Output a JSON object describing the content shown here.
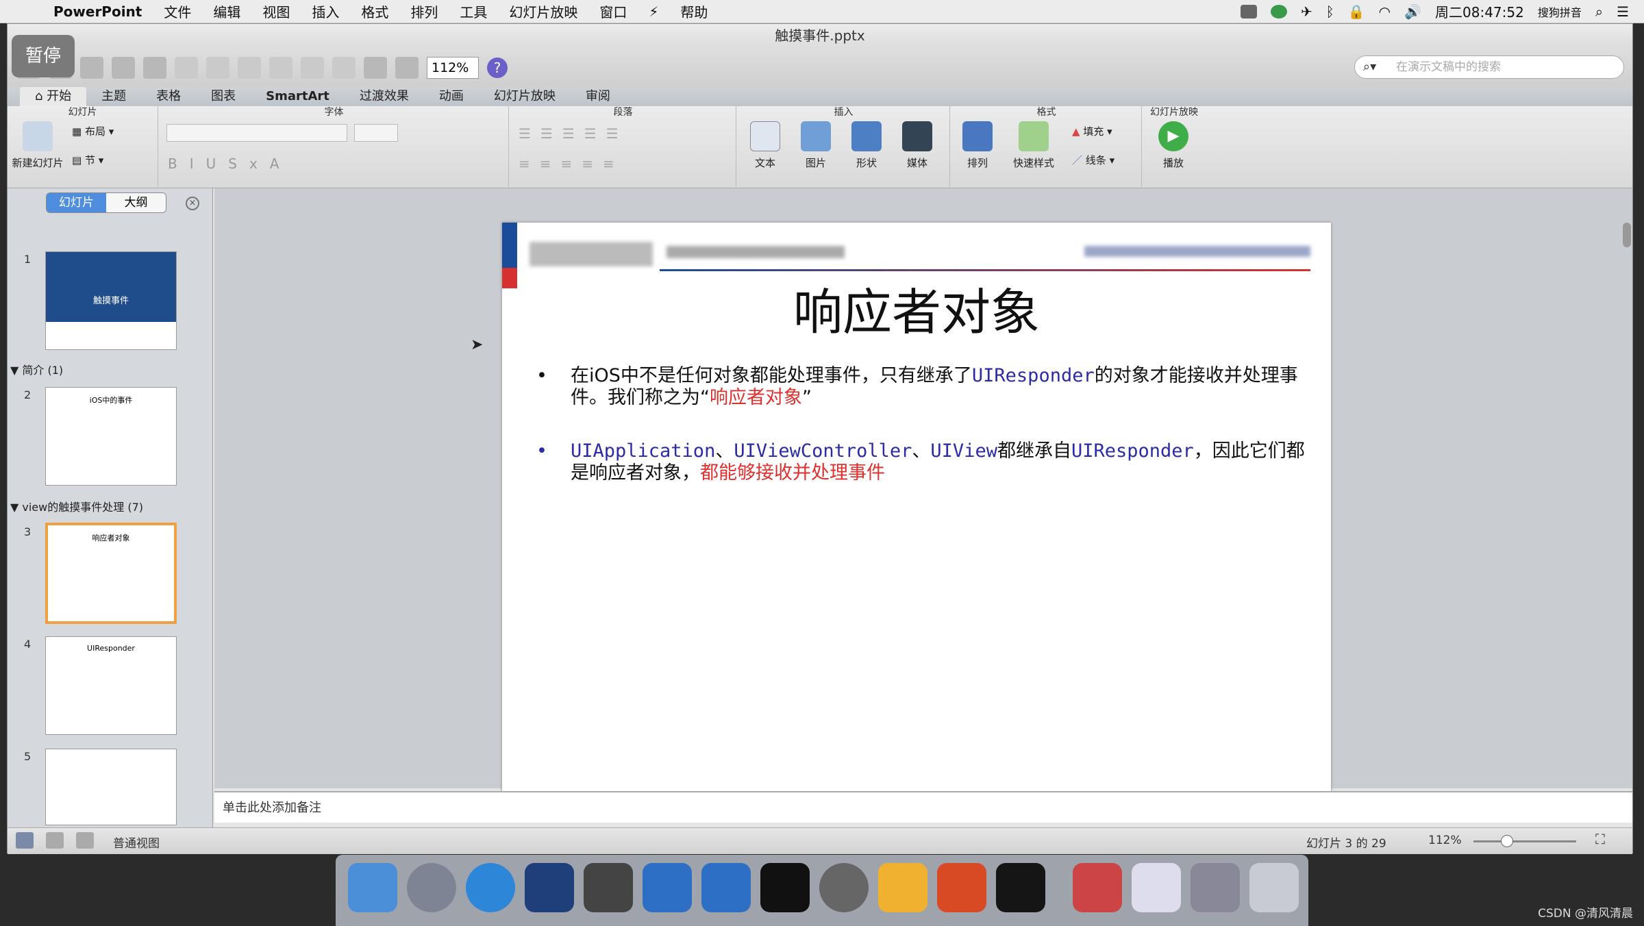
{
  "menubar": {
    "app": "PowerPoint",
    "items": [
      "文件",
      "编辑",
      "视图",
      "插入",
      "格式",
      "排列",
      "工具",
      "幻灯片放映",
      "窗口",
      "帮助"
    ],
    "clock": "周二08:47:52",
    "ime": "搜狗拼音"
  },
  "window": {
    "title": "触摸事件.pptx",
    "pause_label": "暂停",
    "zoom": "112%",
    "help": "?",
    "search_placeholder": "在演示文稿中的搜索"
  },
  "ribbon": {
    "tabs": [
      "开始",
      "主题",
      "表格",
      "图表",
      "SmartArt",
      "过渡效果",
      "动画",
      "幻灯片放映",
      "审阅"
    ],
    "groups": {
      "slides": "幻灯片",
      "font": "字体",
      "paragraph": "段落",
      "insert": "插入",
      "format": "格式",
      "slideshow": "幻灯片放映"
    },
    "labels": {
      "new_slide": "新建幻灯片",
      "layout": "布局",
      "section": "节",
      "text": "文本",
      "picture": "图片",
      "shape": "形状",
      "media": "媒体",
      "arrange": "排列",
      "quick_styles": "快速样式",
      "fill": "填充",
      "line": "线条",
      "play": "播放"
    }
  },
  "sidebar": {
    "tab_slides": "幻灯片",
    "tab_outline": "大纲",
    "section_intro": "简介 (1)",
    "section_view": "view的触摸事件处理 (7)",
    "slides": [
      {
        "num": "1",
        "title": "触摸事件"
      },
      {
        "num": "2",
        "title": "iOS中的事件"
      },
      {
        "num": "3",
        "title": "响应者对象"
      },
      {
        "num": "4",
        "title": "UIResponder"
      },
      {
        "num": "5",
        "title": ""
      }
    ]
  },
  "slide": {
    "title": "响应者对象",
    "b1_a": "在iOS中不是任何对象都能处理事件，只有继承了",
    "b1_code": "UIResponder",
    "b1_b": "的对象才能接收并处理事件。我们称之为“",
    "b1_red": "响应者对象",
    "b1_c": "”",
    "b2_code1": "UIApplication",
    "sep1": "、",
    "b2_code2": "UIViewController",
    "sep2": "、",
    "b2_code3": "UIView",
    "b2_a": "都继承自",
    "b2_code4": "UIResponder",
    "b2_b": "，因此它们都是响应者对象，",
    "b2_red": "都能够接收并处理事件"
  },
  "notes": "单击此处添加备注",
  "status": {
    "view": "普通视图",
    "slide_pos": "幻灯片 3 的 29",
    "zoom": "112%"
  },
  "watermark": "CSDN @清风清晨"
}
